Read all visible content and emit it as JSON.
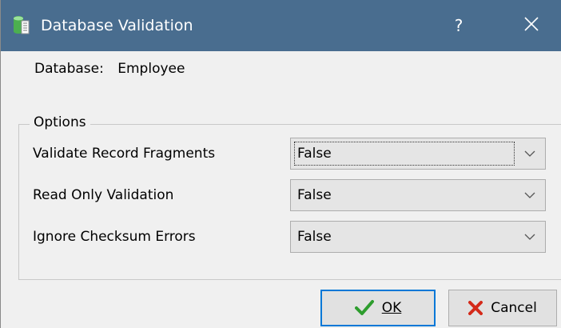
{
  "window": {
    "title": "Database Validation",
    "help_label": "?",
    "icons": {
      "app": "database-icon",
      "close": "close-icon"
    },
    "colors": {
      "titlebar": "#496d8f",
      "focus_border": "#0078d7"
    }
  },
  "database": {
    "label": "Database:",
    "value": "Employee"
  },
  "options": {
    "group_title": "Options",
    "items": [
      {
        "label": "Validate Record Fragments",
        "value": "False"
      },
      {
        "label": "Read Only Validation",
        "value": "False"
      },
      {
        "label": "Ignore Checksum Errors",
        "value": "False"
      }
    ]
  },
  "buttons": {
    "ok": {
      "label": "OK",
      "icon": "checkmark-icon"
    },
    "cancel": {
      "label": "Cancel",
      "icon": "x-mark-icon"
    }
  }
}
